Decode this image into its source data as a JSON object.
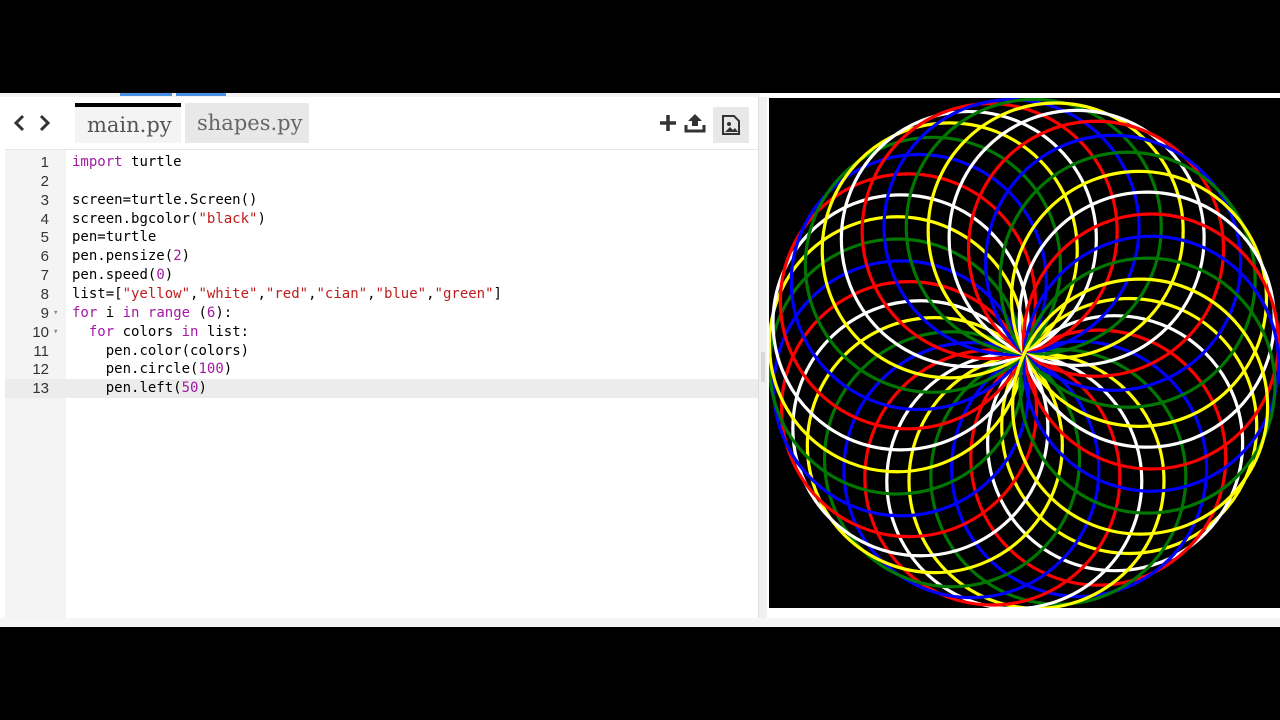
{
  "nav": {
    "back_icon": "chevron-left-icon",
    "forward_icon": "chevron-right-icon"
  },
  "tabs": [
    {
      "label": "main.py",
      "active": true
    },
    {
      "label": "shapes.py",
      "active": false
    }
  ],
  "toolbar": {
    "icons": [
      "plus-icon",
      "upload-icon",
      "image-icon"
    ]
  },
  "code": {
    "lines": [
      {
        "n": "1",
        "text": "import turtle"
      },
      {
        "n": "2",
        "text": ""
      },
      {
        "n": "3",
        "text": "screen=turtle.Screen()"
      },
      {
        "n": "4",
        "text": "screen.bgcolor(\"black\")"
      },
      {
        "n": "5",
        "text": "pen=turtle"
      },
      {
        "n": "6",
        "text": "pen.pensize(2)"
      },
      {
        "n": "7",
        "text": "pen.speed(0)"
      },
      {
        "n": "8",
        "text": "list=[\"yellow\",\"white\",\"red\",\"cian\",\"blue\",\"green\"]"
      },
      {
        "n": "9",
        "text": "for i in range (6):",
        "fold": true
      },
      {
        "n": "10",
        "text": "  for colors in list:",
        "fold": true
      },
      {
        "n": "11",
        "text": "    pen.color(colors)"
      },
      {
        "n": "12",
        "text": "    pen.circle(100)"
      },
      {
        "n": "13",
        "text": "    pen.left(50)",
        "current": true
      }
    ]
  },
  "output": {
    "background": "#000000",
    "pen_colors": [
      "#ffff00",
      "#ffffff",
      "#ff0000",
      "#0000ff",
      "#007700"
    ],
    "turn_degrees": 50,
    "outer_loops": 6
  },
  "theme": {
    "keyword": "#a31aa3",
    "string": "#c21b1b",
    "number": "#a31aa3"
  }
}
